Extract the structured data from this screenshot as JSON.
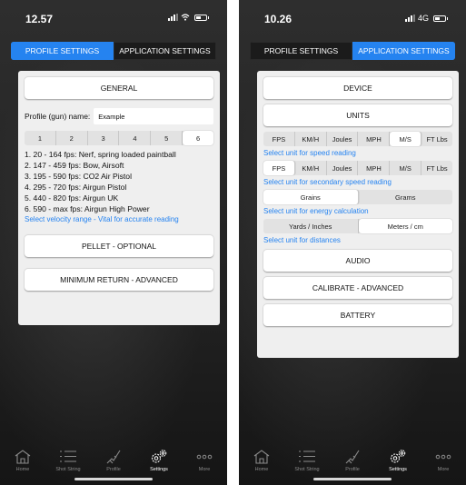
{
  "left": {
    "status": {
      "time": "12.57",
      "network": ""
    },
    "segments": [
      "PROFILE SETTINGS",
      "APPLICATION SETTINGS"
    ],
    "active_segment": 0,
    "general_label": "GENERAL",
    "profile_name_label": "Profile (gun) name:",
    "profile_name_value": "Example",
    "profile_tabs": [
      "1",
      "2",
      "3",
      "4",
      "5",
      "6"
    ],
    "selected_tab": 5,
    "ranges": [
      "1. 20 - 164 fps: Nerf, spring loaded paintball",
      "2. 147 - 459 fps: Bow, Airsoft",
      "3. 195 - 590 fps: CO2 Air Pistol",
      "4. 295 - 720 fps: Airgun Pistol",
      "5. 440 - 820 fps: Airgun UK",
      "6. 590 - max fps: Airgun High Power"
    ],
    "range_hint": "Select velocity range - Vital for accurate reading",
    "pellet_label": "PELLET - OPTIONAL",
    "min_return_label": "MINIMUM RETURN - ADVANCED"
  },
  "right": {
    "status": {
      "time": "10.26",
      "network": "4G"
    },
    "segments": [
      "PROFILE SETTINGS",
      "APPLICATION SETTINGS"
    ],
    "active_segment": 1,
    "device_label": "DEVICE",
    "units_label": "UNITS",
    "speed_units": [
      "FPS",
      "KM/H",
      "Joules",
      "MPH",
      "M/S",
      "FT Lbs"
    ],
    "speed_selected": 4,
    "speed_hint": "Select unit for speed reading",
    "secondary_units": [
      "FPS",
      "KM/H",
      "Joules",
      "MPH",
      "M/S",
      "FT Lbs"
    ],
    "secondary_selected": 0,
    "secondary_hint": "Select unit for secondary speed reading",
    "energy_units": [
      "Grains",
      "Grams"
    ],
    "energy_selected": 0,
    "energy_hint": "Select unit for energy calculation",
    "distance_units": [
      "Yards / Inches",
      "Meters / cm"
    ],
    "distance_selected": 1,
    "distance_hint": "Select unit for distances",
    "audio_label": "AUDIO",
    "calibrate_label": "CALIBRATE - ADVANCED",
    "battery_label": "BATTERY"
  },
  "tabbar": {
    "items": [
      "Home",
      "Shot String",
      "Profile",
      "Settings",
      "More"
    ],
    "active": 3
  },
  "colors": {
    "accent": "#2583f0",
    "panel": "#efefef"
  }
}
